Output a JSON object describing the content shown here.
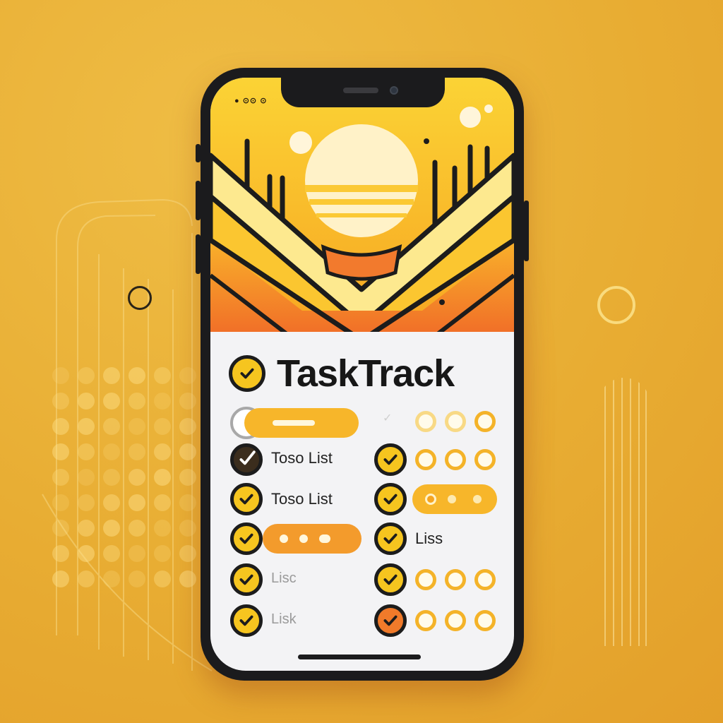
{
  "app": {
    "title": "TaskTrack",
    "status_text": "● ⊙⊙ ⊙"
  },
  "tasks": {
    "left": [
      {
        "label": "",
        "state": "empty"
      },
      {
        "label": "Toso List",
        "state": "checked-dark"
      },
      {
        "label": "Toso List",
        "state": "checked"
      },
      {
        "label": "",
        "state": "checked"
      },
      {
        "label": "Lisc",
        "state": "checked"
      },
      {
        "label": "Lisk",
        "state": "checked"
      }
    ],
    "right": [
      {
        "label": "",
        "state": "faint"
      },
      {
        "label": "",
        "state": "checked"
      },
      {
        "label": "",
        "state": "checked"
      },
      {
        "label": "Liss",
        "state": "checked"
      },
      {
        "label": "",
        "state": "checked"
      },
      {
        "label": "",
        "state": "checked-orange"
      }
    ]
  },
  "colors": {
    "background": "#e8ad33",
    "accent_yellow": "#f6c51f",
    "accent_orange": "#f07a2a",
    "phone_frame": "#1b1b1d",
    "screen": "#f3f3f5"
  },
  "icons": [
    "checkmark-icon",
    "circle-toggle-icon",
    "signal-icon",
    "battery-icon"
  ]
}
